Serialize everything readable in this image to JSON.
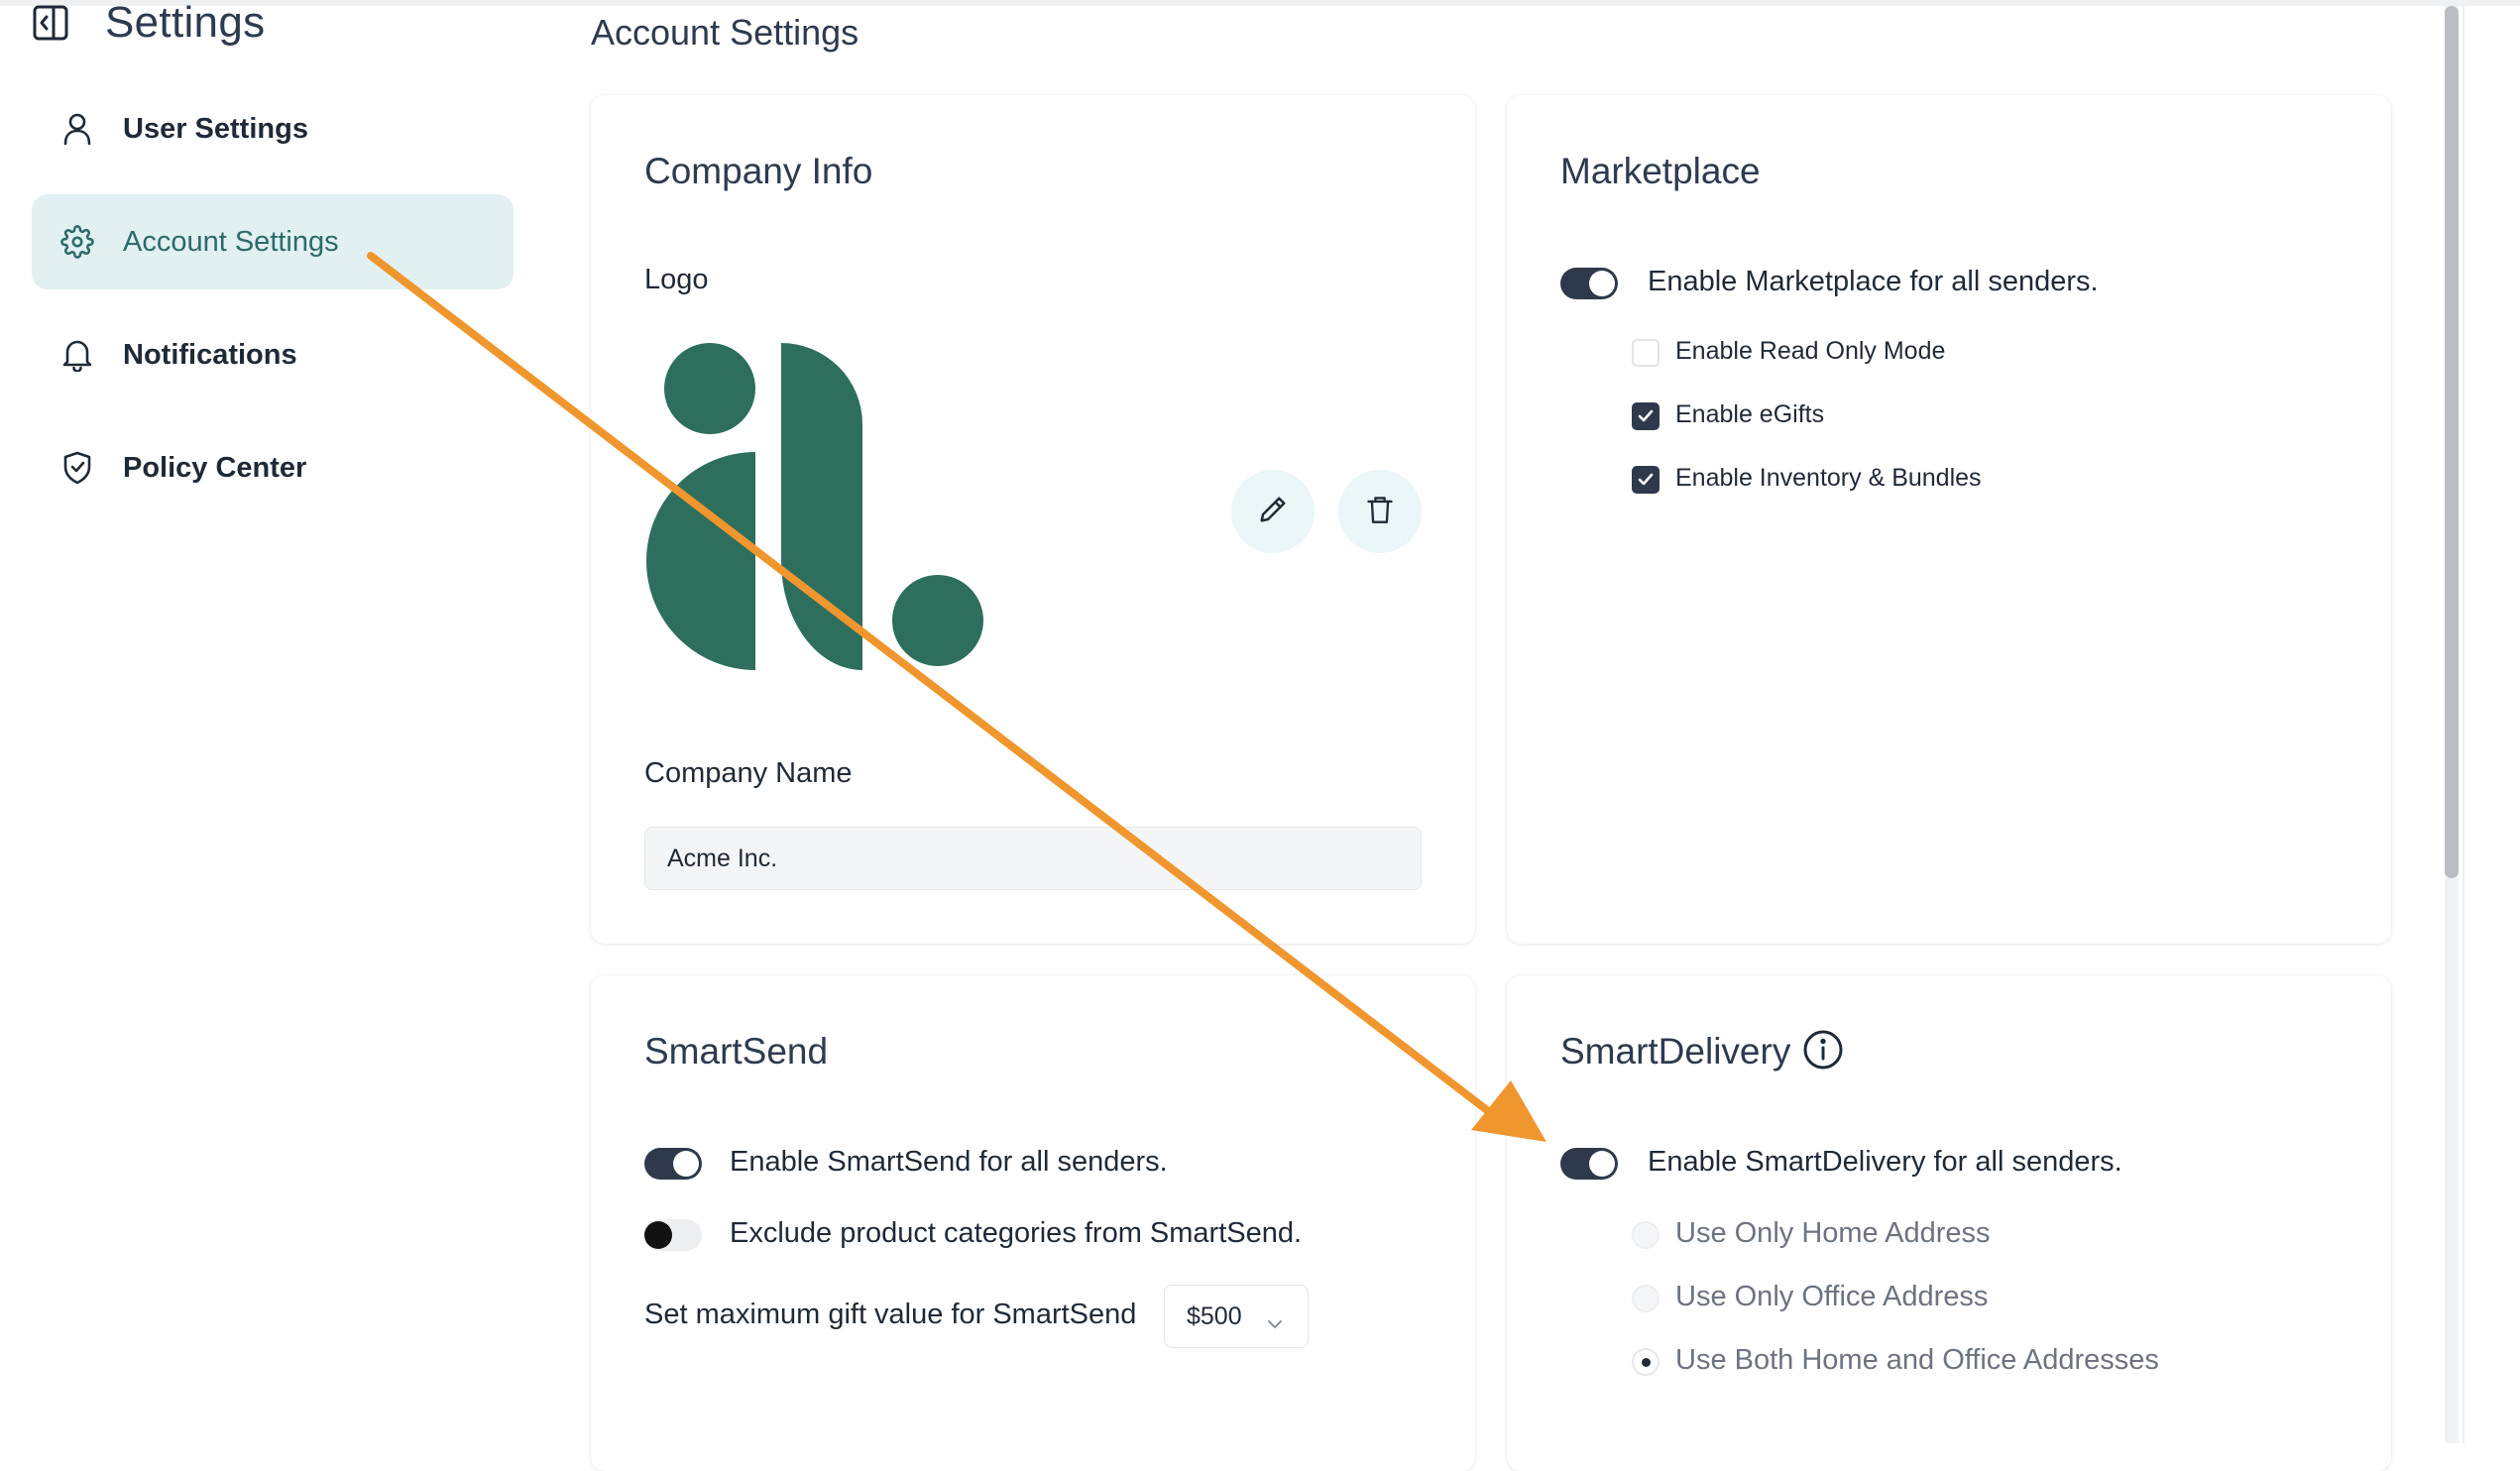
{
  "sidebar": {
    "title": "Settings",
    "collapse_icon": "sidebar-collapse-icon",
    "items": [
      {
        "label": "User Settings",
        "icon": "user-icon",
        "active": false
      },
      {
        "label": "Account Settings",
        "icon": "gear-icon",
        "active": true
      },
      {
        "label": "Notifications",
        "icon": "bell-icon",
        "active": false
      },
      {
        "label": "Policy Center",
        "icon": "shield-check-icon",
        "active": false
      }
    ]
  },
  "main": {
    "title": "Account Settings",
    "company_info": {
      "title": "Company Info",
      "logo_label": "Logo",
      "logo_color": "#2e6e5d",
      "edit_icon": "pencil-icon",
      "delete_icon": "trash-icon",
      "company_name_label": "Company Name",
      "company_name_value": "Acme Inc."
    },
    "marketplace": {
      "title": "Marketplace",
      "toggle": {
        "label": "Enable Marketplace for all senders.",
        "on": true
      },
      "options": [
        {
          "label": "Enable Read Only Mode",
          "checked": false
        },
        {
          "label": "Enable eGifts",
          "checked": true
        },
        {
          "label": "Enable Inventory & Bundles",
          "checked": true
        }
      ]
    },
    "smartsend": {
      "title": "SmartSend",
      "toggles": [
        {
          "label": "Enable SmartSend for all senders.",
          "on": true
        },
        {
          "label": "Exclude product categories from SmartSend.",
          "on": false
        }
      ],
      "max_value_label": "Set maximum gift value for SmartSend",
      "max_value": "$500"
    },
    "smartdelivery": {
      "title": "SmartDelivery",
      "info_icon": "info-icon",
      "toggle": {
        "label": "Enable SmartDelivery for all senders.",
        "on": true
      },
      "options": [
        {
          "label": "Use Only Home Address",
          "selected": false
        },
        {
          "label": "Use Only Office Address",
          "selected": false
        },
        {
          "label": "Use Both Home and Office Addresses",
          "selected": true
        }
      ]
    }
  },
  "annotation": {
    "arrow_color": "#f0962e"
  },
  "colors": {
    "accent": "#2e3a4c",
    "active_nav_bg": "#e2f0f1",
    "active_nav_text": "#2a6b6a"
  }
}
